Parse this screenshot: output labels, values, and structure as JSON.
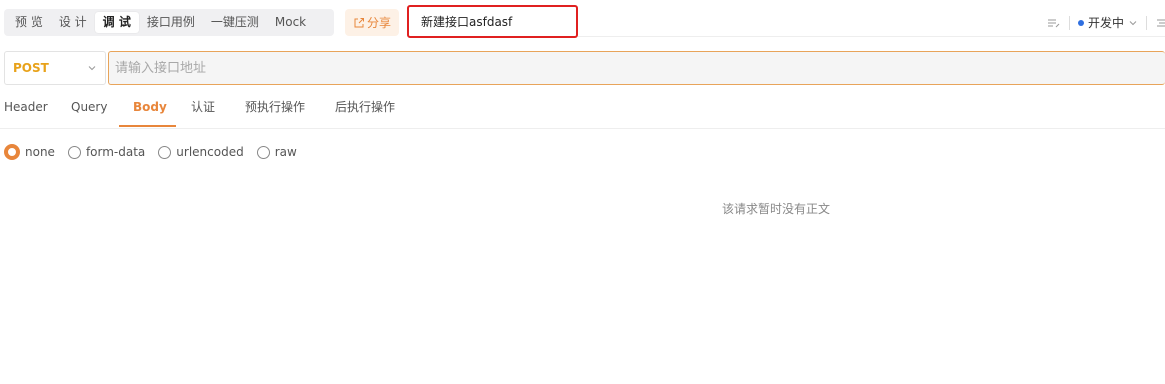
{
  "mode_tabs": [
    {
      "label": "预 览"
    },
    {
      "label": "设 计"
    },
    {
      "label": "调 试",
      "active": true
    },
    {
      "label": "接口用例"
    },
    {
      "label": "一键压测"
    },
    {
      "label": "Mock"
    }
  ],
  "share": {
    "label": "分享",
    "icon": "share-icon"
  },
  "api_name": {
    "value": "新建接口asfdasf"
  },
  "status": {
    "label": "开发中",
    "icon": "chevron-down-icon",
    "dot_color": "#2f6fe0"
  },
  "request": {
    "method": "POST",
    "method_color": "#e8a21a",
    "url_placeholder": "请输入接口地址",
    "url_value": ""
  },
  "request_tabs": [
    {
      "label": "Header"
    },
    {
      "label": "Query"
    },
    {
      "label": "Body",
      "active": true
    },
    {
      "label": "认证"
    },
    {
      "label": "预执行操作"
    },
    {
      "label": "后执行操作"
    }
  ],
  "body_types": [
    {
      "label": "none",
      "selected": true
    },
    {
      "label": "form-data"
    },
    {
      "label": "urlencoded"
    },
    {
      "label": "raw"
    }
  ],
  "body_empty_message": "该请求暂时没有正文",
  "colors": {
    "accent": "#e8863b",
    "highlight_border": "#e02020"
  }
}
